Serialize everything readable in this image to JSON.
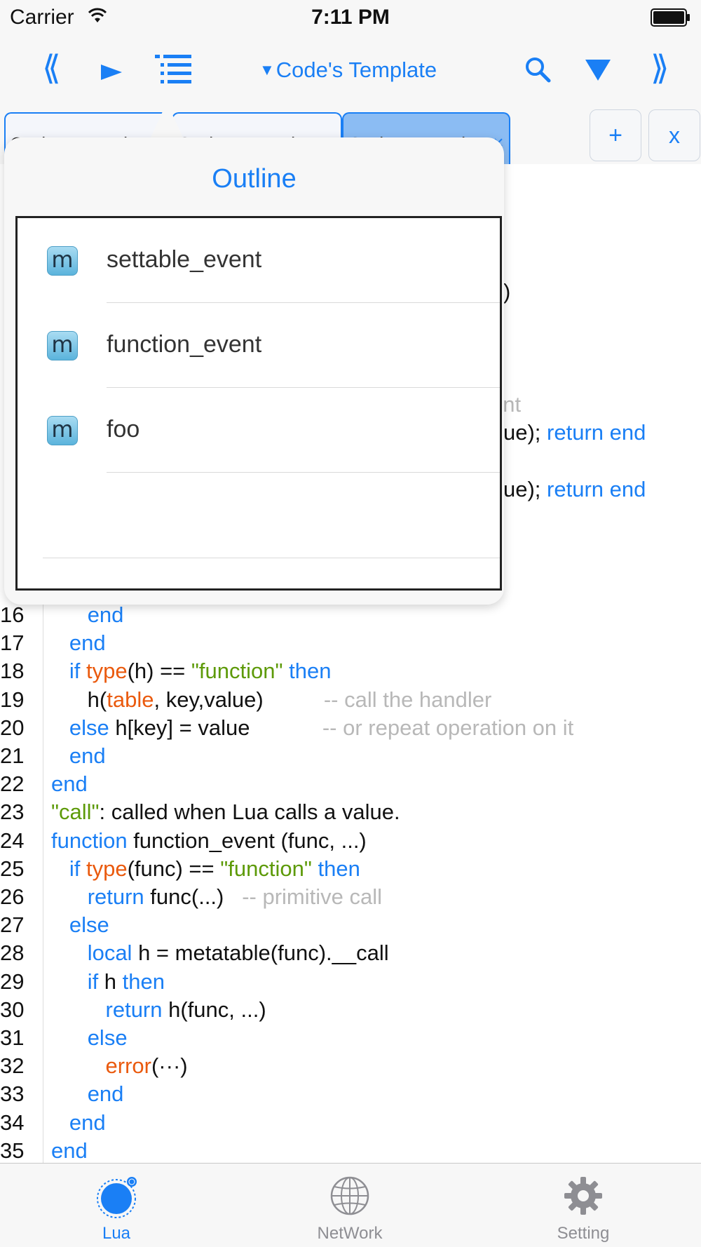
{
  "status_bar": {
    "carrier": "Carrier",
    "time": "7:11 PM"
  },
  "toolbar": {
    "prev": "⟪",
    "next": "⟫",
    "template": "Code's Template",
    "icons": [
      "prev-icon",
      "play-icon",
      "outline-icon",
      "search-icon",
      "filter-icon",
      "next-icon"
    ],
    "accent": "#1a7ff5"
  },
  "tabs": [
    {
      "label": "Code's Template",
      "close": "×",
      "active": false
    },
    {
      "label": "Code's Template",
      "close": "×",
      "active": false
    },
    {
      "label": "Code's Template",
      "close": "×",
      "active": true
    }
  ],
  "tab_actions": {
    "add": "+",
    "close": "x"
  },
  "outline": {
    "title": "Outline",
    "items": [
      {
        "icon": "m",
        "label": "settable_event"
      },
      {
        "icon": "m",
        "label": "function_event"
      },
      {
        "icon": "m",
        "label": "foo"
      }
    ]
  },
  "editor": {
    "partial_right": [
      {
        "text": ")"
      },
      {
        "text": "ent"
      },
      {
        "text": "ue);",
        "kw": "return end"
      },
      {
        "text": "ue);",
        "kw": "return end"
      }
    ],
    "lines": [
      {
        "n": "16",
        "tokens": [
          {
            "t": "      "
          },
          {
            "t": "end",
            "c": "kw"
          }
        ]
      },
      {
        "n": "17",
        "tokens": [
          {
            "t": "   "
          },
          {
            "t": "end",
            "c": "kw"
          }
        ]
      },
      {
        "n": "18",
        "tokens": [
          {
            "t": "   "
          },
          {
            "t": "if ",
            "c": "kw"
          },
          {
            "t": "type",
            "c": "fn"
          },
          {
            "t": "(h) == "
          },
          {
            "t": "\"function\"",
            "c": "str"
          },
          {
            "t": " then",
            "c": "kw"
          }
        ]
      },
      {
        "n": "19",
        "tokens": [
          {
            "t": "      h("
          },
          {
            "t": "table",
            "c": "fn"
          },
          {
            "t": ", key,value)          "
          },
          {
            "t": "-- call the handler",
            "c": "cm"
          }
        ]
      },
      {
        "n": "20",
        "tokens": [
          {
            "t": "   "
          },
          {
            "t": "else",
            "c": "kw"
          },
          {
            "t": " h[key] = value            "
          },
          {
            "t": "-- or repeat operation on it",
            "c": "cm"
          }
        ]
      },
      {
        "n": "21",
        "tokens": [
          {
            "t": "   "
          },
          {
            "t": "end",
            "c": "kw"
          }
        ]
      },
      {
        "n": "22",
        "tokens": [
          {
            "t": "end",
            "c": "kw"
          }
        ]
      },
      {
        "n": "23",
        "tokens": [
          {
            "t": "\"call\"",
            "c": "str"
          },
          {
            "t": ": called when Lua calls a value."
          }
        ]
      },
      {
        "n": "24",
        "tokens": [
          {
            "t": "function",
            "c": "kw"
          },
          {
            "t": " function_event (func, ...)"
          }
        ]
      },
      {
        "n": "25",
        "tokens": [
          {
            "t": "   "
          },
          {
            "t": "if ",
            "c": "kw"
          },
          {
            "t": "type",
            "c": "fn"
          },
          {
            "t": "(func) == "
          },
          {
            "t": "\"function\"",
            "c": "str"
          },
          {
            "t": " then",
            "c": "kw"
          }
        ]
      },
      {
        "n": "26",
        "tokens": [
          {
            "t": "      "
          },
          {
            "t": "return",
            "c": "kw"
          },
          {
            "t": " func(...)   "
          },
          {
            "t": "-- primitive call",
            "c": "cm"
          }
        ]
      },
      {
        "n": "27",
        "tokens": [
          {
            "t": "   "
          },
          {
            "t": "else",
            "c": "kw"
          }
        ]
      },
      {
        "n": "28",
        "tokens": [
          {
            "t": "      "
          },
          {
            "t": "local",
            "c": "kw"
          },
          {
            "t": " h = metatable(func).__call"
          }
        ]
      },
      {
        "n": "29",
        "tokens": [
          {
            "t": "      "
          },
          {
            "t": "if",
            "c": "kw"
          },
          {
            "t": " h "
          },
          {
            "t": "then",
            "c": "kw"
          }
        ]
      },
      {
        "n": "30",
        "tokens": [
          {
            "t": "         "
          },
          {
            "t": "return",
            "c": "kw"
          },
          {
            "t": " h(func, ...)"
          }
        ]
      },
      {
        "n": "31",
        "tokens": [
          {
            "t": "      "
          },
          {
            "t": "else",
            "c": "kw"
          }
        ]
      },
      {
        "n": "32",
        "tokens": [
          {
            "t": "         "
          },
          {
            "t": "error",
            "c": "fn"
          },
          {
            "t": "(···)"
          }
        ]
      },
      {
        "n": "33",
        "tokens": [
          {
            "t": "      "
          },
          {
            "t": "end",
            "c": "kw"
          }
        ]
      },
      {
        "n": "34",
        "tokens": [
          {
            "t": "   "
          },
          {
            "t": "end",
            "c": "kw"
          }
        ]
      },
      {
        "n": "35",
        "tokens": [
          {
            "t": "end",
            "c": "kw"
          }
        ]
      }
    ]
  },
  "tabbar": {
    "items": [
      {
        "label": "Lua",
        "icon": "lua-icon",
        "selected": true
      },
      {
        "label": "NetWork",
        "icon": "globe-icon",
        "selected": false
      },
      {
        "label": "Setting",
        "icon": "gear-icon",
        "selected": false
      }
    ]
  }
}
